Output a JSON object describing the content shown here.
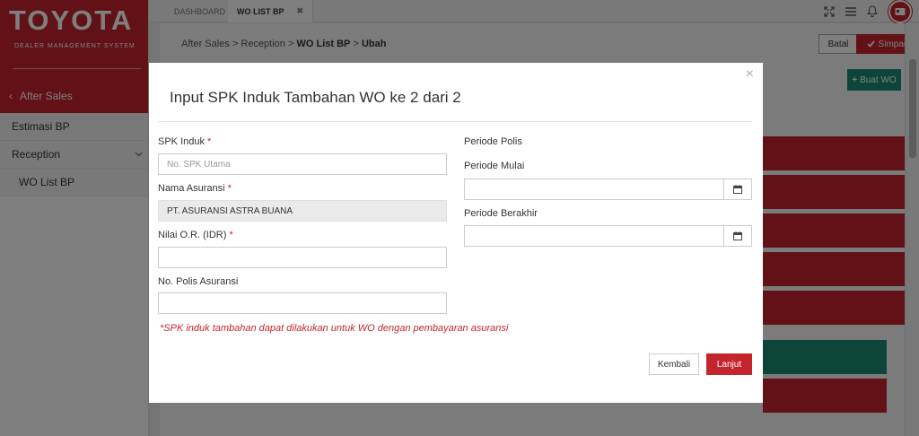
{
  "brand": {
    "logo": "TOYOTA",
    "subtitle": "DEALER MANAGEMENT SYSTEM",
    "back_label": "After Sales"
  },
  "sidebar": {
    "items": [
      {
        "label": "Estimasi BP"
      },
      {
        "label": "Reception"
      },
      {
        "label": "WO List BP"
      }
    ]
  },
  "tabs": [
    {
      "label": "DASHBOARD"
    },
    {
      "label": "WO LIST BP"
    }
  ],
  "tab_close": "✖",
  "breadcrumb": {
    "items": [
      "After Sales",
      "Reception",
      "WO List BP",
      "Ubah"
    ],
    "separator": ">"
  },
  "toolbar": {
    "batal_label": "Batal",
    "simpan_label": "Simpan",
    "buat_wo_label": "Buat WO"
  },
  "modal": {
    "close": "×",
    "title": "Input SPK Induk Tambahan WO ke 2 dari 2",
    "spk_induk": {
      "label": "SPK Induk",
      "required": "*",
      "placeholder": "No. SPK Utama",
      "value": ""
    },
    "nama_asuransi": {
      "label": "Nama Asuransi",
      "required": "*",
      "value": "PT. ASURANSI ASTRA BUANA"
    },
    "nilai_or": {
      "label": "Nilai O.R. (IDR)",
      "required": "*",
      "value": ""
    },
    "no_polis": {
      "label": "No. Polis Asuransi",
      "value": ""
    },
    "periode_polis": {
      "label": "Periode Polis"
    },
    "periode_mulai": {
      "label": "Periode Mulai",
      "value": ""
    },
    "periode_berakhir": {
      "label": "Periode Berakhir",
      "value": ""
    },
    "note": "*SPK induk tambahan dapat dilakukan untuk WO dengan pembayaran asuransi",
    "kembali_label": "Kembali",
    "lanjut_label": "Lanjut"
  },
  "colors": {
    "primary_red": "#c4252d",
    "green": "#1d8a74",
    "overlay": "rgba(0,0,0,0.5)"
  },
  "icons": [
    "chevron-left-icon",
    "chevron-down-icon",
    "close-icon",
    "expand-icon",
    "menu-icon",
    "bell-icon",
    "avatar",
    "check-icon",
    "plus-icon",
    "calendar-icon"
  ]
}
